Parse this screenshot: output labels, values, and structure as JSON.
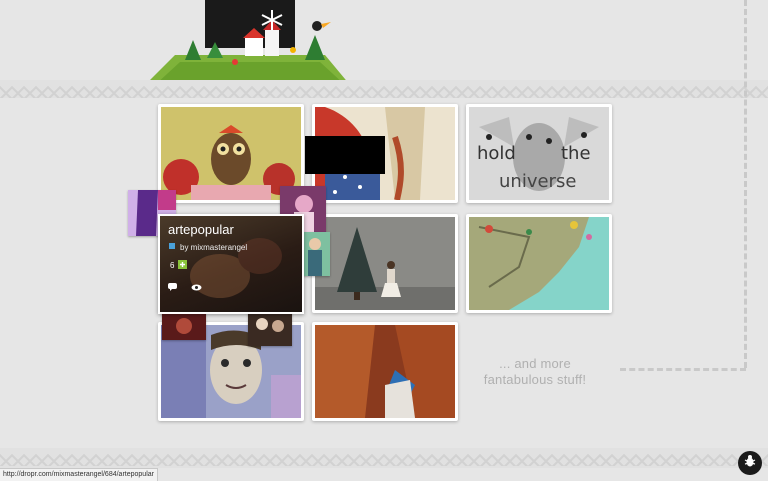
{
  "hover": {
    "title": "artepopular",
    "author": "by mixmasterangel",
    "count": "6"
  },
  "more": {
    "line1": "... and more",
    "line2": "fantabulous stuff!"
  },
  "status_url": "http://dropr.com/mixmasterangel/684/artepopular",
  "icons": [
    "bug-icon",
    "comment-icon",
    "eye-icon",
    "user-icon"
  ],
  "colors": {
    "background": "#e6e6e6",
    "tile_border": "#ffffff",
    "more_text": "#b0b0b0",
    "bug_button": "#1b1b1b"
  }
}
